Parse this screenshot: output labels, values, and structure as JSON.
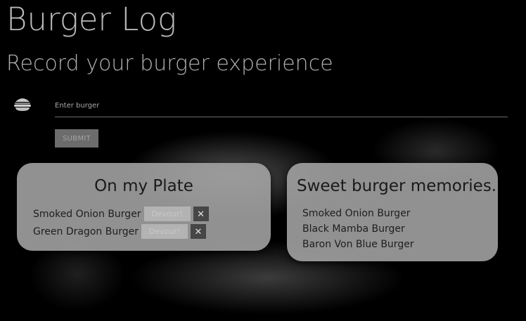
{
  "header": {
    "title": "Burger Log",
    "subtitle": "Record your burger experience"
  },
  "form": {
    "icon": "burger-icon",
    "placeholder": "Enter burger",
    "value": "",
    "submit_label": "SUBMIT"
  },
  "plate": {
    "title": "On my Plate",
    "items": [
      {
        "name": "Smoked Onion Burger",
        "devour_label": "Devour!",
        "delete_label": "✕"
      },
      {
        "name": "Green Dragon Burger",
        "devour_label": "Devour!",
        "delete_label": "✕"
      }
    ]
  },
  "memories": {
    "title": "Sweet burger memories.",
    "items": [
      "Smoked Onion Burger",
      "Black Mamba Burger",
      "Baron Von Blue Burger"
    ]
  }
}
